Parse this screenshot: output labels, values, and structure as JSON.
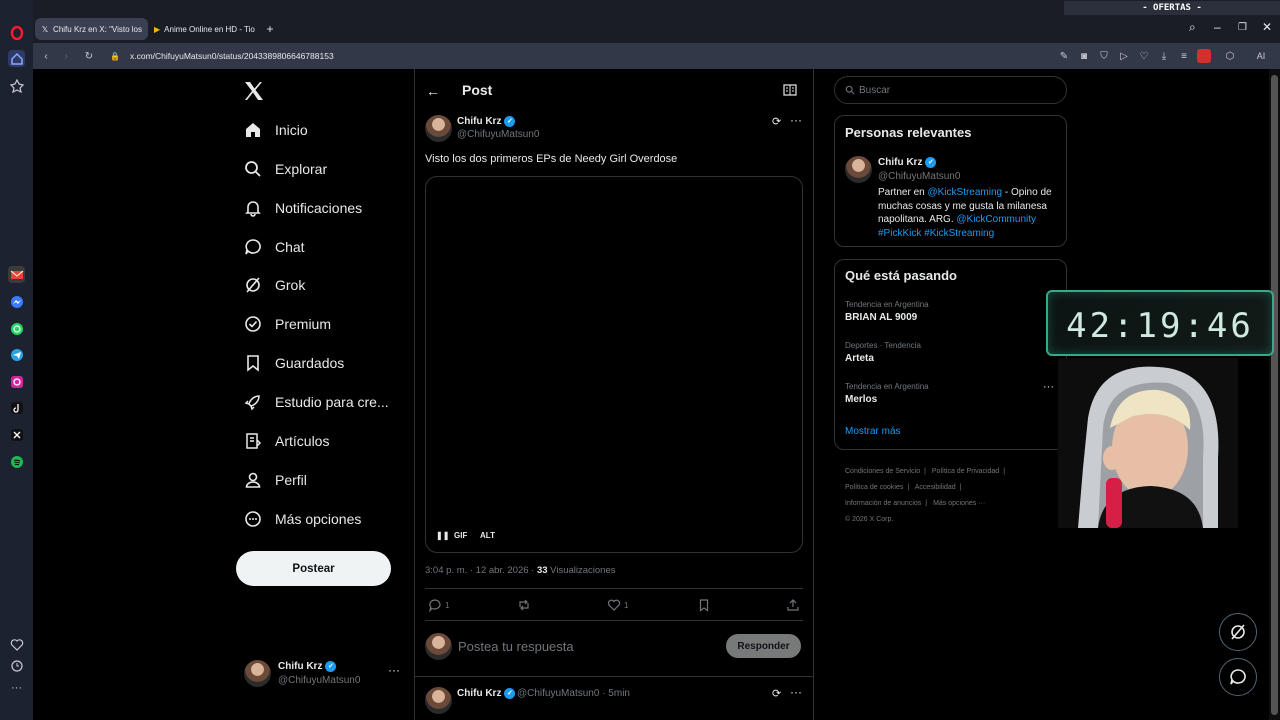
{
  "browser": {
    "tabs": [
      {
        "title": "Chifu Krz en X: \"Visto los",
        "active": true
      },
      {
        "title": "Anime Online en HD - Tio",
        "active": false
      }
    ],
    "url": "x.com/ChifuyuMatsun0/status/2043389806646788153",
    "promo": "- OFERTAS -",
    "ai_label": "AI"
  },
  "nav": {
    "items": [
      {
        "label": "Inicio",
        "icon": "home-icon"
      },
      {
        "label": "Explorar",
        "icon": "search-icon"
      },
      {
        "label": "Notificaciones",
        "icon": "bell-icon"
      },
      {
        "label": "Chat",
        "icon": "chat-icon"
      },
      {
        "label": "Grok",
        "icon": "grok-icon"
      },
      {
        "label": "Premium",
        "icon": "premium-icon"
      },
      {
        "label": "Guardados",
        "icon": "bookmark-icon"
      },
      {
        "label": "Estudio para cre...",
        "icon": "rocket-icon"
      },
      {
        "label": "Artículos",
        "icon": "article-icon"
      },
      {
        "label": "Perfil",
        "icon": "profile-icon"
      },
      {
        "label": "Más opciones",
        "icon": "more-icon"
      }
    ],
    "post_button": "Postear",
    "account": {
      "name": "Chifu Krz",
      "handle": "@ChifuyuMatsun0"
    }
  },
  "post": {
    "header_title": "Post",
    "author": {
      "name": "Chifu Krz",
      "handle": "@ChifuyuMatsun0"
    },
    "text": "Visto los dos primeros EPs de Needy Girl Overdose",
    "media_controls": {
      "pause": "❚❚",
      "gif": "GIF",
      "alt": "ALT"
    },
    "time": "3:04 p. m. · 12 abr. 2026 · ",
    "views_count": "33",
    "views_label": " Visualizaciones",
    "actions": {
      "replies": "1",
      "reposts": "",
      "likes": "1"
    },
    "reply_placeholder": "Postea tu respuesta",
    "reply_button": "Responder",
    "next": {
      "name": "Chifu Krz",
      "meta": "@ChifuyuMatsun0 · 5min"
    }
  },
  "right": {
    "search_placeholder": "Buscar",
    "relevant": {
      "title": "Personas relevantes",
      "name": "Chifu Krz",
      "handle": "@ChifuyuMatsun0",
      "bio_1": "Partner en ",
      "bio_link1": "@KickStreaming",
      "bio_2": " - Opino de muchas cosas y me gusta la milanesa napolitana. ARG. ",
      "bio_link2": "@KickCommunity",
      "bio_link3": "#PickKick",
      "bio_link4": "#KickStreaming"
    },
    "trends": {
      "title": "Qué está pasando",
      "items": [
        {
          "context": "Tendencia en Argentina",
          "name": "BRIAN AL 9009"
        },
        {
          "context": "Deportes · Tendencia",
          "name": "Arteta"
        },
        {
          "context": "Tendencia en Argentina",
          "name": "Merlos"
        }
      ],
      "show_more": "Mostrar más"
    },
    "footer": {
      "terms": "Condiciones de Servicio",
      "privacy": "Política de Privacidad",
      "cookies": "Política de cookies",
      "accessibility": "Accesibilidad",
      "ads": "Información de anuncios",
      "more": "Más opciones ···",
      "copyright": "© 2026 X Corp."
    }
  },
  "overlay": {
    "timer": "42:19:46",
    "timer_color": "#3aa68a"
  },
  "colors": {
    "accent": "#1d9bf0",
    "border": "#2f3336",
    "muted": "#71767b"
  }
}
